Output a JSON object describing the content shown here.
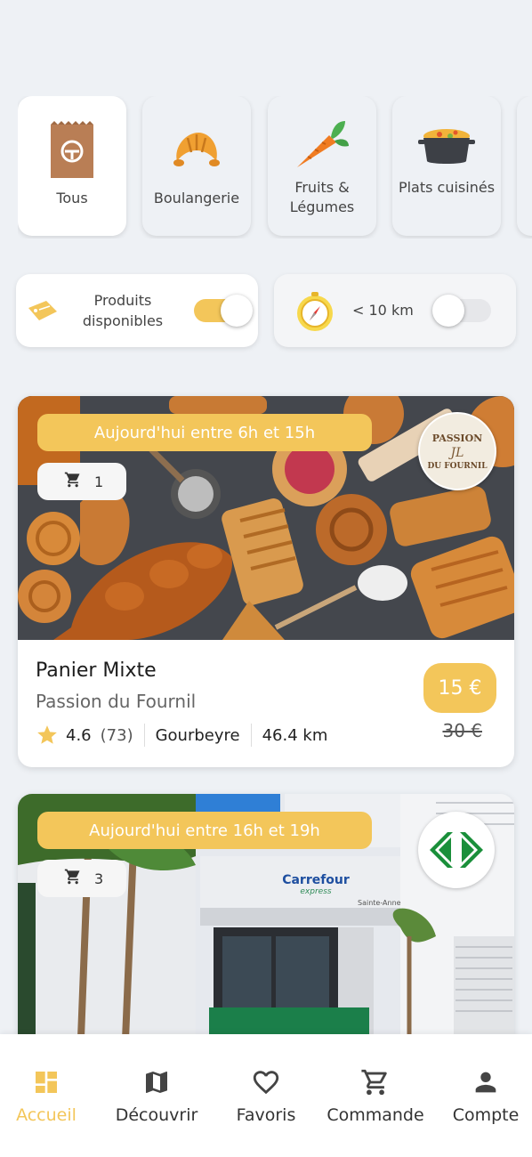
{
  "categories": [
    {
      "label": "Tous",
      "icon": "bag-icon",
      "active": true
    },
    {
      "label": "Boulangerie",
      "icon": "croissant-icon",
      "active": false
    },
    {
      "label": "Fruits & Légumes",
      "icon": "carrot-icon",
      "active": false
    },
    {
      "label": "Plats cuisinés",
      "icon": "pot-icon",
      "active": false
    }
  ],
  "filters": {
    "available": {
      "label": "Produits disponibles",
      "on": true
    },
    "distance": {
      "label": "< 10 km",
      "on": false
    }
  },
  "offers": [
    {
      "time": "Aujourd'hui entre 6h et 15h",
      "cart_count": "1",
      "title": "Panier Mixte",
      "store": "Passion du Fournil",
      "rating": "4.6",
      "reviews": "(73)",
      "city": "Gourbeyre",
      "distance": "46.4 km",
      "price": "15 €",
      "old_price": "30 €",
      "logo_top": "PASSION",
      "logo_bottom": "DU FOURNIL"
    },
    {
      "time": "Aujourd'hui entre 16h et 19h",
      "cart_count": "3",
      "store_sign": "Carrefour",
      "store_sign_sub": "express",
      "store_sign_place": "Sainte-Anne"
    }
  ],
  "nav": [
    {
      "label": "Accueil",
      "icon": "dashboard-icon",
      "active": true
    },
    {
      "label": "Découvrir",
      "icon": "map-icon",
      "active": false
    },
    {
      "label": "Favoris",
      "icon": "heart-icon",
      "active": false
    },
    {
      "label": "Commande",
      "icon": "cart-icon",
      "active": false
    },
    {
      "label": "Compte",
      "icon": "person-icon",
      "active": false
    }
  ],
  "colors": {
    "accent": "#f3c65a",
    "nav_active": "#f3c65a",
    "background": "#eef1f5"
  }
}
